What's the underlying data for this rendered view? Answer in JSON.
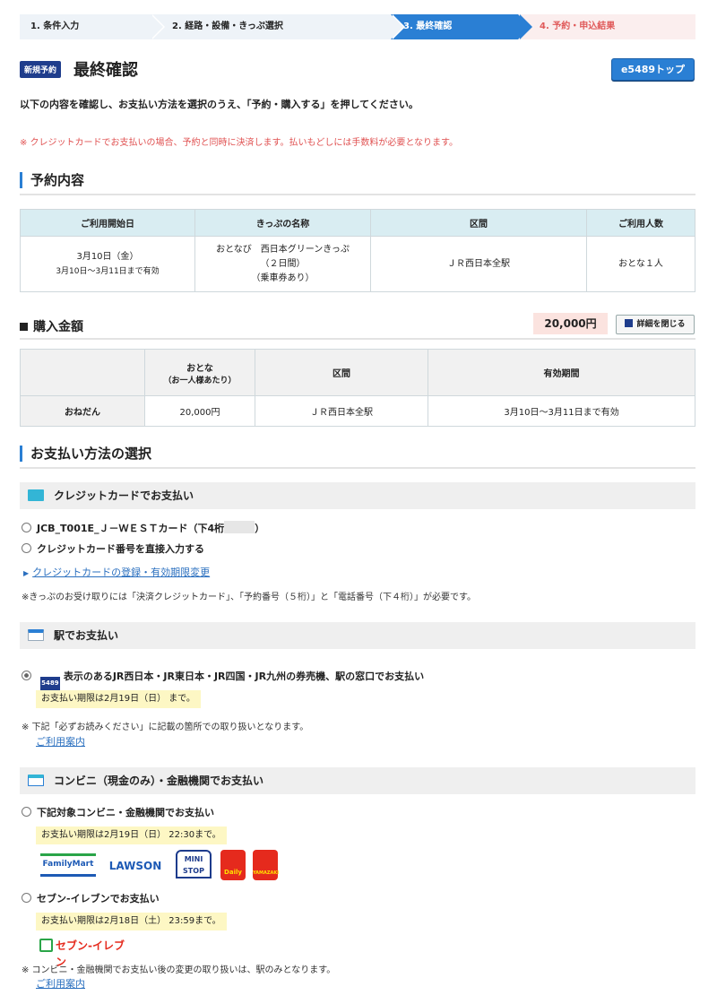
{
  "steps": [
    {
      "label": "1. 条件入力"
    },
    {
      "label": "2. 経路・設備・きっぷ選択"
    },
    {
      "label": "3. 最終確認"
    },
    {
      "label": "4. 予約・申込結果"
    }
  ],
  "header": {
    "badge": "新規予約",
    "title": "最終確認",
    "top_button": "e5489トップ"
  },
  "lead": "以下の内容を確認し、お支払い方法を選択のうえ、「予約・購入する」を押してください。",
  "warning": "※ クレジットカードでお支払いの場合、予約と同時に決済します。払いもどしには手数料が必要となります。",
  "reservation": {
    "title": "予約内容",
    "headers": [
      "ご利用開始日",
      "きっぷの名称",
      "区間",
      "ご利用人数"
    ],
    "start_date": "3月10日（金）",
    "valid": "3月10日～3月11日まで有効",
    "ticket_name_1": "おとなび　西日本グリーンきっぷ",
    "ticket_name_2": "（２日間）",
    "ticket_name_3": "（乗車券あり）",
    "section": "ＪＲ西日本全駅",
    "people": "おとな１人"
  },
  "purchase": {
    "title": "購入金額",
    "total": "20,000円",
    "close_button": "詳細を閉じる",
    "headers": [
      "おとな",
      "（お一人様あたり）",
      "区間",
      "有効期間"
    ],
    "row_label": "おねだん",
    "price": "20,000円",
    "section": "ＪＲ西日本全駅",
    "valid": "3月10日～3月11日まで有効"
  },
  "payment": {
    "title": "お支払い方法の選択",
    "credit": {
      "head": "クレジットカードでお支払い",
      "option1_prefix": "JCB_T001E_Ｊ－ＷＥＳＴカード（下4桁",
      "option1_suffix": "）",
      "option2": "クレジットカード番号を直接入力する",
      "link": "クレジットカードの登録・有効期限変更",
      "note": "※きっぷのお受け取りには「決済クレジットカード」、「予約番号（５桁）」と「電話番号（下４桁）」が必要です。"
    },
    "station": {
      "head": "駅でお支払い",
      "option": "表示のあるJR西日本・JR東日本・JR四国・JR九州の券売機、駅の窓口でお支払い",
      "badge": "5489",
      "deadline": "お支払い期限は2月19日（日） まで。",
      "note": "※ 下記「必ずお読みください」に記載の箇所での取り扱いとなります。",
      "link": "ご利用案内"
    },
    "convenience": {
      "head": "コンビニ（現金のみ）・金融機関でお支払い",
      "option1": "下記対象コンビニ・金融機関でお支払い",
      "deadline1": "お支払い期限は2月19日（日） 22:30まで。",
      "logos": [
        "FamilyMart",
        "LAWSON",
        "MINI STOP",
        "Daily",
        "YAMAZAKI"
      ],
      "option2": "セブン-イレブンでお支払い",
      "deadline2": "お支払い期限は2月18日（土） 23:59まで。",
      "seven_logo": "セブン-イレブン",
      "note": "※ コンビニ・金融機関でお支払い後の変更の取り扱いは、駅のみとなります。",
      "link": "ご利用案内"
    }
  },
  "colors": {
    "accent": "#2a7fd4",
    "navy": "#1f3d8c",
    "warn": "#e05252",
    "highlight": "#fdf7c4"
  }
}
